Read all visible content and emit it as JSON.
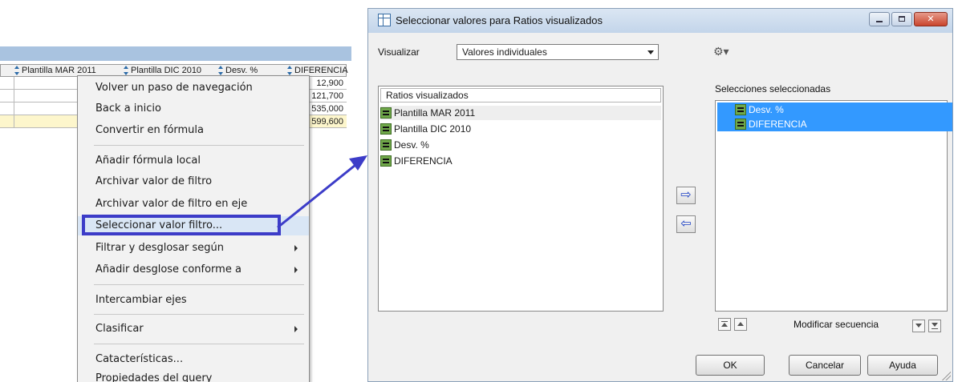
{
  "sheet": {
    "columns": [
      {
        "label": "Plantilla MAR 2011"
      },
      {
        "label": "Plantilla DIC 2010"
      },
      {
        "label": "Desv. %"
      },
      {
        "label": "DIFERENCIA"
      }
    ],
    "diferencia_values": [
      "12,900",
      "121,700",
      "535,000",
      "599,600"
    ]
  },
  "context_menu": {
    "items": [
      {
        "label": "Volver un paso de navegación"
      },
      {
        "label": "Back a inicio"
      },
      {
        "label": "Convertir en fórmula"
      },
      {
        "label": "Añadir fórmula local"
      },
      {
        "label": "Archivar valor de filtro"
      },
      {
        "label": "Archivar valor de filtro en eje"
      },
      {
        "label": "Seleccionar valor filtro..."
      },
      {
        "label": "Filtrar y desglosar según"
      },
      {
        "label": "Añadir desglose conforme a"
      },
      {
        "label": "Intercambiar ejes"
      },
      {
        "label": "Clasificar"
      },
      {
        "label": "Catacterísticas..."
      },
      {
        "label": "Propiedades del query"
      }
    ]
  },
  "dialog": {
    "title": "Seleccionar valores para Ratios visualizados",
    "visualizar_label": "Visualizar",
    "visualizar_value": "Valores individuales",
    "left_list_header": "Ratios visualizados",
    "left_items": [
      {
        "label": "Plantilla MAR 2011"
      },
      {
        "label": "Plantilla DIC 2010"
      },
      {
        "label": "Desv. %"
      },
      {
        "label": "DIFERENCIA"
      }
    ],
    "right_list_title": "Selecciones seleccionadas",
    "right_items": [
      {
        "label": "Desv. %"
      },
      {
        "label": "DIFERENCIA"
      }
    ],
    "move_right_symbol": "⇨",
    "move_left_symbol": "⇦",
    "sequence_label": "Modificar secuencia",
    "ok_label": "OK",
    "cancel_label": "Cancelar",
    "help_label": "Ayuda",
    "wrench_symbol": "⚙▾"
  },
  "colors": {
    "selection": "#3399ff",
    "callout": "#3c3cc8",
    "total_row": "#fdf6cc"
  }
}
